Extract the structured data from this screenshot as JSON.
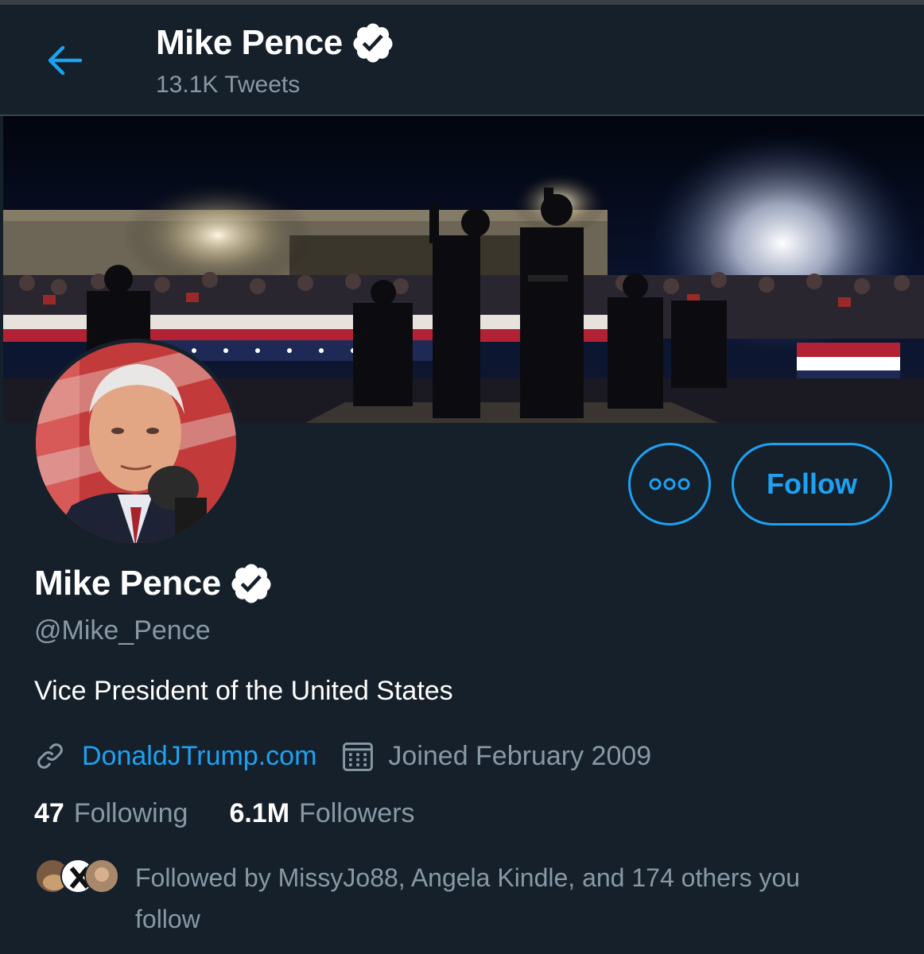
{
  "header": {
    "name": "Mike Pence",
    "tweet_count": "13.1K Tweets"
  },
  "actions": {
    "follow_label": "Follow"
  },
  "profile": {
    "name": "Mike Pence",
    "handle": "@Mike_Pence",
    "bio": "Vice President of the United States",
    "website": "DonaldJTrump.com",
    "joined": "Joined February 2009"
  },
  "stats": {
    "following_count": "47",
    "following_label": "Following",
    "followers_count": "6.1M",
    "followers_label": "Followers"
  },
  "followed_by": {
    "text": "Followed by MissyJo88, Angela Kindle, and 174 others you follow"
  },
  "icons": {
    "back": "arrow-left-icon",
    "verified": "verified-badge-icon",
    "more": "more-dots-icon",
    "link": "link-icon",
    "calendar": "calendar-icon"
  },
  "colors": {
    "background": "#15202b",
    "accent": "#1da1f2",
    "secondary_text": "#8899a6",
    "border": "#38444d"
  }
}
